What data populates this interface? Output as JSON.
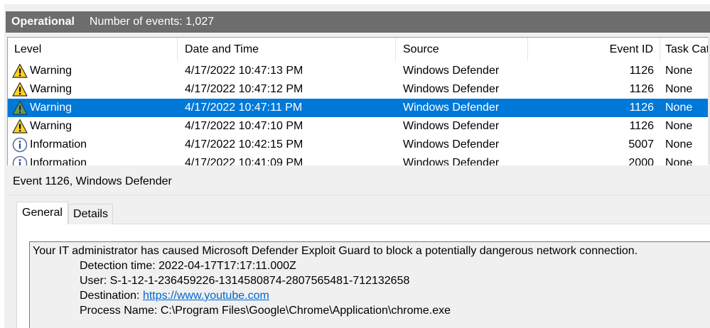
{
  "header": {
    "title": "Operational",
    "event_count": "Number of events: 1,027"
  },
  "columns": {
    "level": "Level",
    "date_time": "Date and Time",
    "source": "Source",
    "event_id": "Event ID",
    "task_category": "Task Cate"
  },
  "rows": [
    {
      "level": "Warning",
      "icon": "warning-icon",
      "date": "4/17/2022 10:47:13 PM",
      "source": "Windows Defender",
      "event_id": "1126",
      "task": "None",
      "selected": false
    },
    {
      "level": "Warning",
      "icon": "warning-icon",
      "date": "4/17/2022 10:47:12 PM",
      "source": "Windows Defender",
      "event_id": "1126",
      "task": "None",
      "selected": false
    },
    {
      "level": "Warning",
      "icon": "warning-icon",
      "date": "4/17/2022 10:47:11 PM",
      "source": "Windows Defender",
      "event_id": "1126",
      "task": "None",
      "selected": true
    },
    {
      "level": "Warning",
      "icon": "warning-icon",
      "date": "4/17/2022 10:47:10 PM",
      "source": "Windows Defender",
      "event_id": "1126",
      "task": "None",
      "selected": false
    },
    {
      "level": "Information",
      "icon": "info-icon",
      "date": "4/17/2022 10:42:15 PM",
      "source": "Windows Defender",
      "event_id": "5007",
      "task": "None",
      "selected": false
    },
    {
      "level": "Information",
      "icon": "info-icon",
      "date": "4/17/2022 10:41:09 PM",
      "source": "Windows Defender",
      "event_id": "2000",
      "task": "None",
      "selected": false
    }
  ],
  "detail": {
    "title": "Event 1126, Windows Defender",
    "tabs": {
      "general": "General",
      "details": "Details"
    },
    "message": {
      "line1": "Your IT administrator has caused Microsoft Defender Exploit Guard to block a potentially dangerous network connection.",
      "detection_time": "Detection time: 2022-04-17T17:17:11.000Z",
      "user": "User: S-1-12-1-236459226-1314580874-2807565481-712132658",
      "destination_label": "Destination: ",
      "destination_url": "https://www.youtube.com",
      "process_name": "Process Name: C:\\Program Files\\Google\\Chrome\\Application\\chrome.exe"
    }
  },
  "colors": {
    "selection": "#0078d7",
    "header_bar": "#6d6d6d",
    "link": "#0066cc",
    "warning_yellow": "#ffd700"
  }
}
